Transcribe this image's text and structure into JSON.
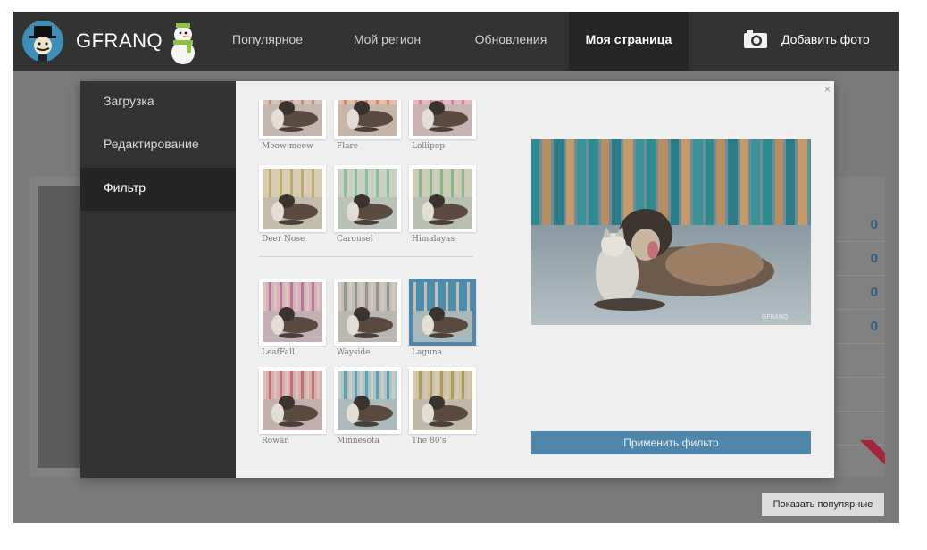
{
  "header": {
    "logo_text": "GFRANQ",
    "nav": [
      {
        "label": "Популярное",
        "active": false
      },
      {
        "label": "Мой регион",
        "active": false
      },
      {
        "label": "Обновления",
        "active": false
      },
      {
        "label": "Моя страница",
        "active": true
      }
    ],
    "add_photo_label": "Добавить фото",
    "add_photo_icon": "camera-icon"
  },
  "background": {
    "stats": [
      "0",
      "0",
      "0",
      "0"
    ],
    "show_popular_label": "Показать популярные"
  },
  "modal": {
    "close_symbol": "×",
    "steps": [
      {
        "label": "Загрузка",
        "active": false
      },
      {
        "label": "Редактирование",
        "active": false
      },
      {
        "label": "Фильтр",
        "active": true
      }
    ],
    "filters": [
      {
        "label": "Meow-meow",
        "tint": "#b58a7a",
        "selected": false
      },
      {
        "label": "Flare",
        "tint": "#c9845f",
        "selected": false
      },
      {
        "label": "Lollipop",
        "tint": "#d07a8e",
        "selected": false
      },
      {
        "label": "Deer Nose",
        "tint": "#b7a36a",
        "selected": false
      },
      {
        "label": "Carousel",
        "tint": "#8bb49a",
        "selected": false
      },
      {
        "label": "Himalayas",
        "tint": "#8cab7e",
        "selected": false
      },
      {
        "label": "LeafFall",
        "tint": "#b2708a",
        "selected": false
      },
      {
        "label": "Wayside",
        "tint": "#8e8a84",
        "selected": false
      },
      {
        "label": "Laguna",
        "tint": "#4a8fa8",
        "selected": true
      },
      {
        "label": "Rowan",
        "tint": "#b86a6a",
        "selected": false
      },
      {
        "label": "Minnesota",
        "tint": "#5d97a6",
        "selected": false
      },
      {
        "label": "The 80's",
        "tint": "#a89456",
        "selected": false
      }
    ],
    "preview_watermark": "GFRANQ",
    "apply_label": "Применить фильтр",
    "accent_color": "#4f86aa"
  }
}
